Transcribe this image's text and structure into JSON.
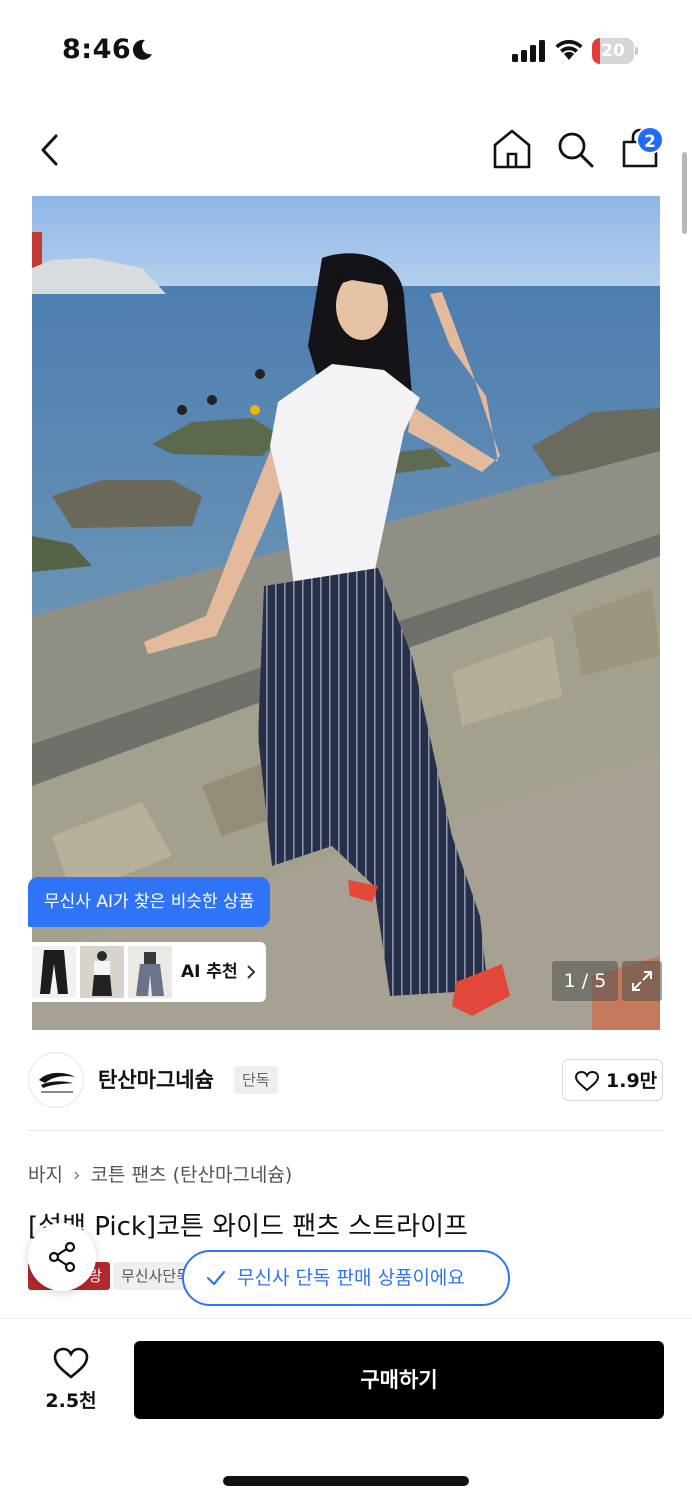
{
  "status_bar": {
    "time": "8:46",
    "battery_level": "20",
    "battery_fraction": 0.2
  },
  "nav": {
    "cart_count": "2"
  },
  "photo": {
    "ai_tag": "무신사 AI가 찾은 비슷한 상품",
    "ai_recommend_label": "AI 추천",
    "counter": "1 / 5"
  },
  "brand": {
    "name": "탄산마그네슘",
    "exclusive_badge": "단독",
    "likes": "1.9만"
  },
  "breadcrumb": [
    "바지",
    "코튼 팬츠 (탄산마그네슘)"
  ],
  "product": {
    "title": "[설백 Pick]코튼 와이드 팬츠 스트라이프",
    "badge_red": "랑",
    "badge_grey": "무신사단독"
  },
  "toast": "무신사 단독 판매 상품이에요",
  "bottom": {
    "wish_count": "2.5천",
    "buy_label": "구매하기"
  },
  "colors": {
    "accent_blue": "#2f74f6",
    "badge_red": "#b3272d",
    "buy_black": "#000000"
  }
}
